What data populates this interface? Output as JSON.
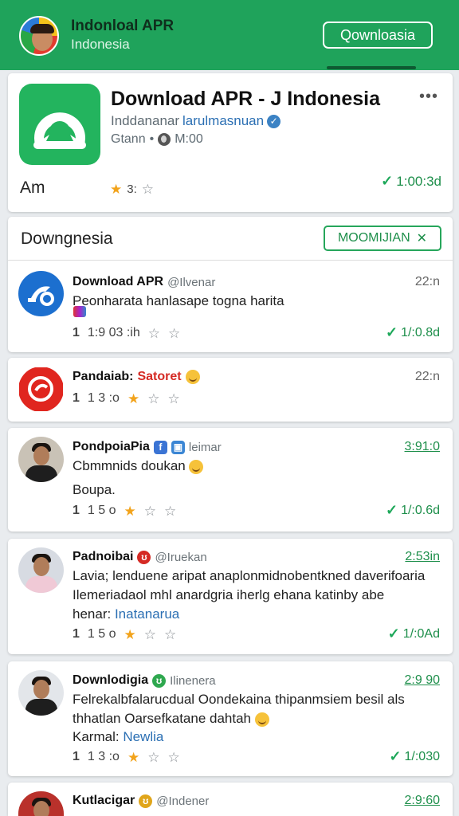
{
  "header": {
    "title": "Indonloal APR",
    "subtitle": "Indonesia",
    "download_button": "Qownloasia"
  },
  "app": {
    "title": "Download APR - J Indonesia",
    "more": "•••",
    "developer_prefix": "Inddananar",
    "developer_link": "larulmasnuan",
    "meta_left": "Gtann",
    "meta_sep": "•",
    "meta_right": "M:00",
    "label": "Am",
    "rating_text": "3:",
    "size": "1:00:3d",
    "colors": {
      "brand": "#23b45e",
      "accent": "#1fa35b"
    }
  },
  "section": {
    "title": "Downgnesia",
    "button": "MOOMIJIAN"
  },
  "posts": [
    {
      "name": "Download APR",
      "handle": "@Ilvenar",
      "time": "22:n",
      "text": "Peonharata hanlasape togna harita",
      "likes": "1",
      "stat": "1:9 03 :ih",
      "size": "1/:0.8d",
      "rating": 0,
      "avatar": "pinned-logo-icon"
    },
    {
      "name": "Pandaiab:",
      "name_red": "Satoret",
      "time": "22:n",
      "likes": "1",
      "stat": "1 3 :o",
      "rating": 1,
      "avatar": "red-app-logo-icon"
    },
    {
      "name": "PondpoiaPia",
      "handle": "leimar",
      "time": "3:91:0",
      "text": "Cbmmnids doukan",
      "text2": "Boupa.",
      "likes": "1",
      "stat": "1 5 o",
      "size": "1/:0.6d",
      "rating": 1,
      "avatar": "person-photo"
    },
    {
      "name": "Padnoibai",
      "handle": "@Iruekan",
      "time": "2:53in",
      "text": "Lavia; lenduene aripat anaplonmidnobentkned daverifoaria Ilemeriadaol mhl anardgria iherlg ehana katinby abe",
      "text_tail_prefix": "henar:",
      "text_tail_link": "Inatanarua",
      "likes": "1",
      "stat": "1 5 o",
      "size": "1/:0Ad",
      "rating": 1,
      "avatar": "person-photo"
    },
    {
      "name": "Downlodigia",
      "handle": "Ilinenera",
      "time": "2:9 90",
      "text": "Felrekalbfalarucdual Oondekaina thipanmsiem besil als thhatlan Oarsefkatane dahtah",
      "text2_prefix": "Karmal:",
      "text2_link": "Newlia",
      "likes": "1",
      "stat": "1 3 :o",
      "size": "1/:030",
      "rating": 1,
      "avatar": "person-photo"
    },
    {
      "name": "Kutlacigar",
      "handle": "@Indener",
      "time": "2:9:60",
      "avatar": "person-photo"
    }
  ]
}
